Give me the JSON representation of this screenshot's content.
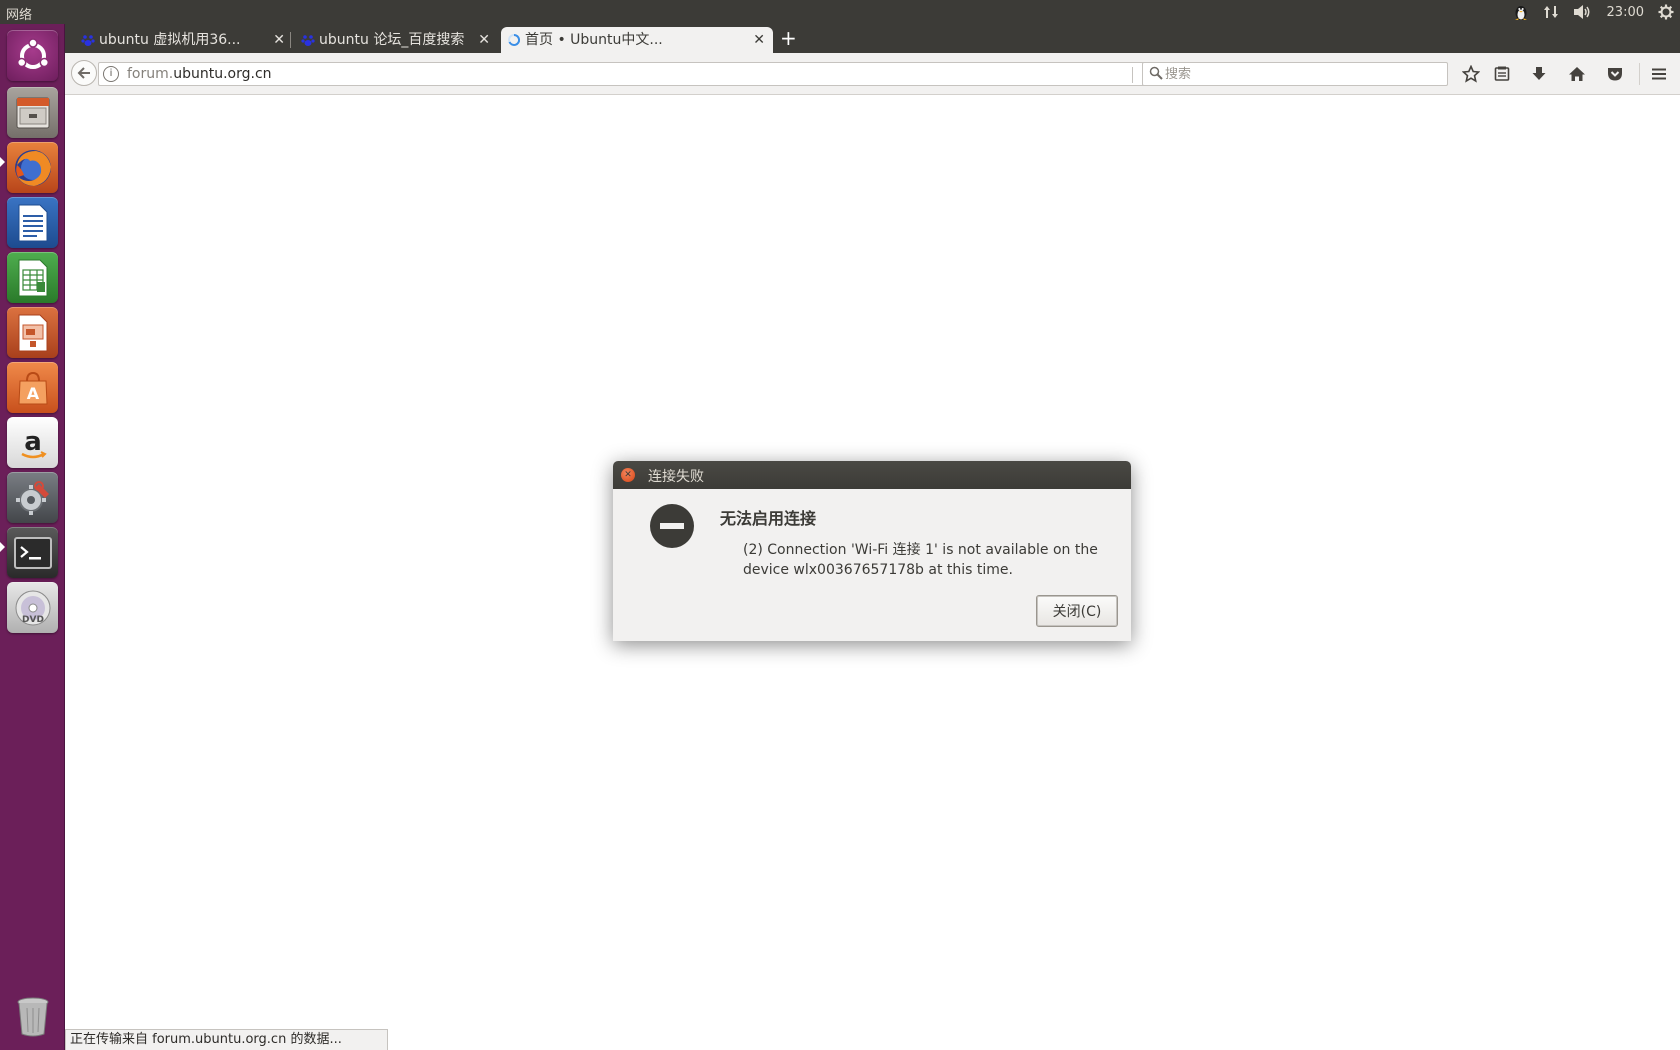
{
  "top_panel": {
    "app_name": "网络",
    "indicators": [
      "qq-penguin-icon",
      "network-arrows-icon",
      "volume-icon"
    ],
    "clock": "23:00",
    "session_icon": "gear-power-icon"
  },
  "launcher": {
    "items": [
      {
        "name": "ubuntu-dash",
        "icon": "ubuntu-logo-icon",
        "bg": "#8b2f75"
      },
      {
        "name": "files",
        "icon": "file-cabinet-icon",
        "bg": "#8a8580"
      },
      {
        "name": "firefox",
        "icon": "firefox-icon",
        "bg": "#c6531e"
      },
      {
        "name": "writer",
        "icon": "document-icon",
        "bg": "#2d5ea8"
      },
      {
        "name": "calc",
        "icon": "spreadsheet-icon",
        "bg": "#3a8a3a"
      },
      {
        "name": "impress",
        "icon": "presentation-icon",
        "bg": "#c4562b"
      },
      {
        "name": "software-center",
        "icon": "shopping-bag-icon",
        "bg": "#e0662d"
      },
      {
        "name": "amazon",
        "icon": "amazon-icon",
        "bg": "#e9e9e9"
      },
      {
        "name": "system-settings",
        "icon": "wrench-gear-icon",
        "bg": "#5a5e63"
      },
      {
        "name": "terminal",
        "icon": "terminal-icon",
        "bg": "#3a3a3a"
      },
      {
        "name": "dvd",
        "icon": "dvd-icon",
        "bg": "#cfcfcf"
      }
    ],
    "trash_icon": "trash-icon"
  },
  "browser": {
    "tabs": [
      {
        "title": "ubuntu 虚拟机用36...",
        "active": false
      },
      {
        "title": "ubuntu 论坛_百度搜索",
        "active": false
      },
      {
        "title": "首页 • Ubuntu中文...",
        "active": true
      }
    ],
    "url_dim": "forum.",
    "url_main": "ubuntu.org.cn",
    "search_placeholder": "搜索",
    "status_text": "正在传输来自 forum.ubuntu.org.cn 的数据..."
  },
  "dialog": {
    "title": "连接失败",
    "heading": "无法启用连接",
    "message": "(2) Connection 'Wi-Fi 连接 1' is not available on the device wlx00367657178b at this time.",
    "close_button": "关闭(C)"
  },
  "colors": {
    "launcher_bg": "#6b1f59",
    "panel_bg": "#3c3b37",
    "chrome_bg": "#f2f1f0",
    "dialog_close": "#e0552a"
  }
}
